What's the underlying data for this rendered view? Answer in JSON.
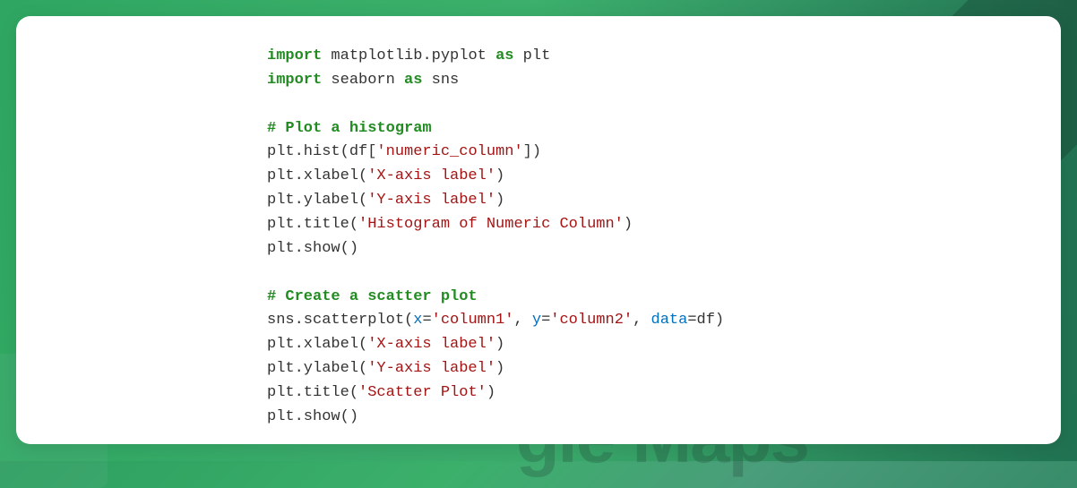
{
  "code": {
    "line1_import": "import",
    "line1_module": "matplotlib.pyplot",
    "line1_as": "as",
    "line1_alias": "plt",
    "line2_import": "import",
    "line2_module": "seaborn",
    "line2_as": "as",
    "line2_alias": "sns",
    "line4_comment": "# Plot a histogram",
    "line5_pre": "plt.hist(df[",
    "line5_str": "'numeric_column'",
    "line5_post": "])",
    "line6_pre": "plt.xlabel(",
    "line6_str": "'X-axis label'",
    "line6_post": ")",
    "line7_pre": "plt.ylabel(",
    "line7_str": "'Y-axis label'",
    "line7_post": ")",
    "line8_pre": "plt.title(",
    "line8_str": "'Histogram of Numeric Column'",
    "line8_post": ")",
    "line9": "plt.show()",
    "line11_comment": "# Create a scatter plot",
    "line12_pre": "sns.scatterplot(",
    "line12_px": "x",
    "line12_eq1": "=",
    "line12_s1": "'column1'",
    "line12_c1": ", ",
    "line12_py": "y",
    "line12_eq2": "=",
    "line12_s2": "'column2'",
    "line12_c2": ", ",
    "line12_pd": "data",
    "line12_eq3": "=df)",
    "line13_pre": "plt.xlabel(",
    "line13_str": "'X-axis label'",
    "line13_post": ")",
    "line14_pre": "plt.ylabel(",
    "line14_str": "'Y-axis label'",
    "line14_post": ")",
    "line15_pre": "plt.title(",
    "line15_str": "'Scatter Plot'",
    "line15_post": ")",
    "line16": "plt.show()"
  }
}
